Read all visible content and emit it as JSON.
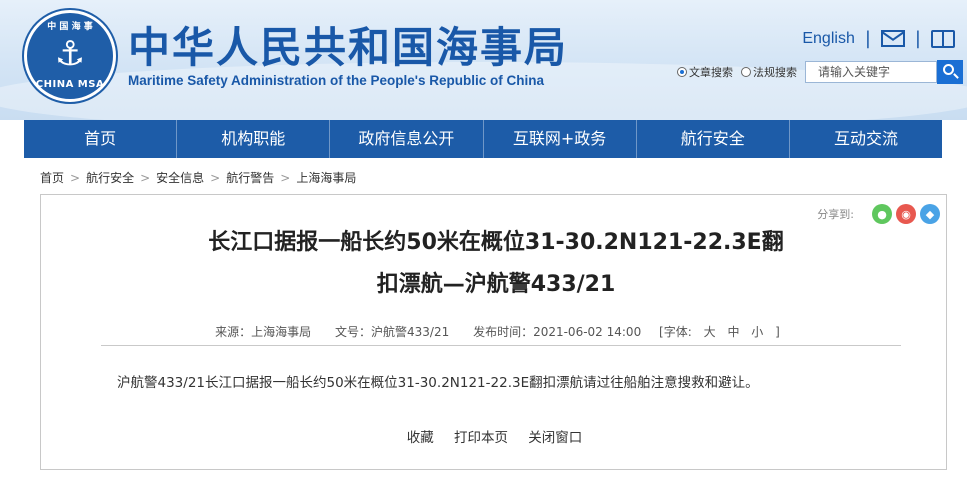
{
  "header": {
    "logo_top": "中 国 海 事",
    "logo_bottom": "CHINA MSA",
    "title_cn": "中华人民共和国海事局",
    "title_en": "Maritime Safety Administration of the People's Republic of China",
    "english_link": "English",
    "sep": "|",
    "search": {
      "radio1": "文章搜索",
      "radio2": "法规搜索",
      "placeholder": "请输入关键字"
    }
  },
  "nav": {
    "items": [
      "首页",
      "机构职能",
      "政府信息公开",
      "互联网+政务",
      "航行安全",
      "互动交流"
    ]
  },
  "breadcrumb": {
    "items": [
      "首页",
      "航行安全",
      "安全信息",
      "航行警告",
      "上海海事局"
    ],
    "sep": ">"
  },
  "article": {
    "share_label": "分享到:",
    "title_line1": "长江口据报一船长约50米在概位31-30.2N121-22.3E翻",
    "title_line2": "扣漂航—沪航警433/21",
    "meta": {
      "source": "来源：上海海事局",
      "doc_no": "文号：沪航警433/21",
      "published": "发布时间：2021-06-02 14:00",
      "font_label": "[字体:",
      "font_large": "大",
      "font_medium": "中",
      "font_small": "小",
      "font_end": "]"
    },
    "body": "沪航警433/21长江口据报一船长约50米在概位31-30.2N121-22.3E翻扣漂航请过往船舶注意搜救和避让。",
    "actions": [
      "收藏",
      "打印本页",
      "关闭窗口"
    ]
  },
  "colors": {
    "brand_blue": "#1d5ca8",
    "wechat_green": "#5fc75e",
    "weibo_red": "#e8584f",
    "qq_blue": "#4aa3e6"
  },
  "icons": {
    "logo": "anchor-emblem",
    "mail": "mail-icon",
    "book": "book-icon",
    "search": "search-icon",
    "share": [
      "wechat-icon",
      "weibo-icon",
      "qq-icon"
    ]
  }
}
